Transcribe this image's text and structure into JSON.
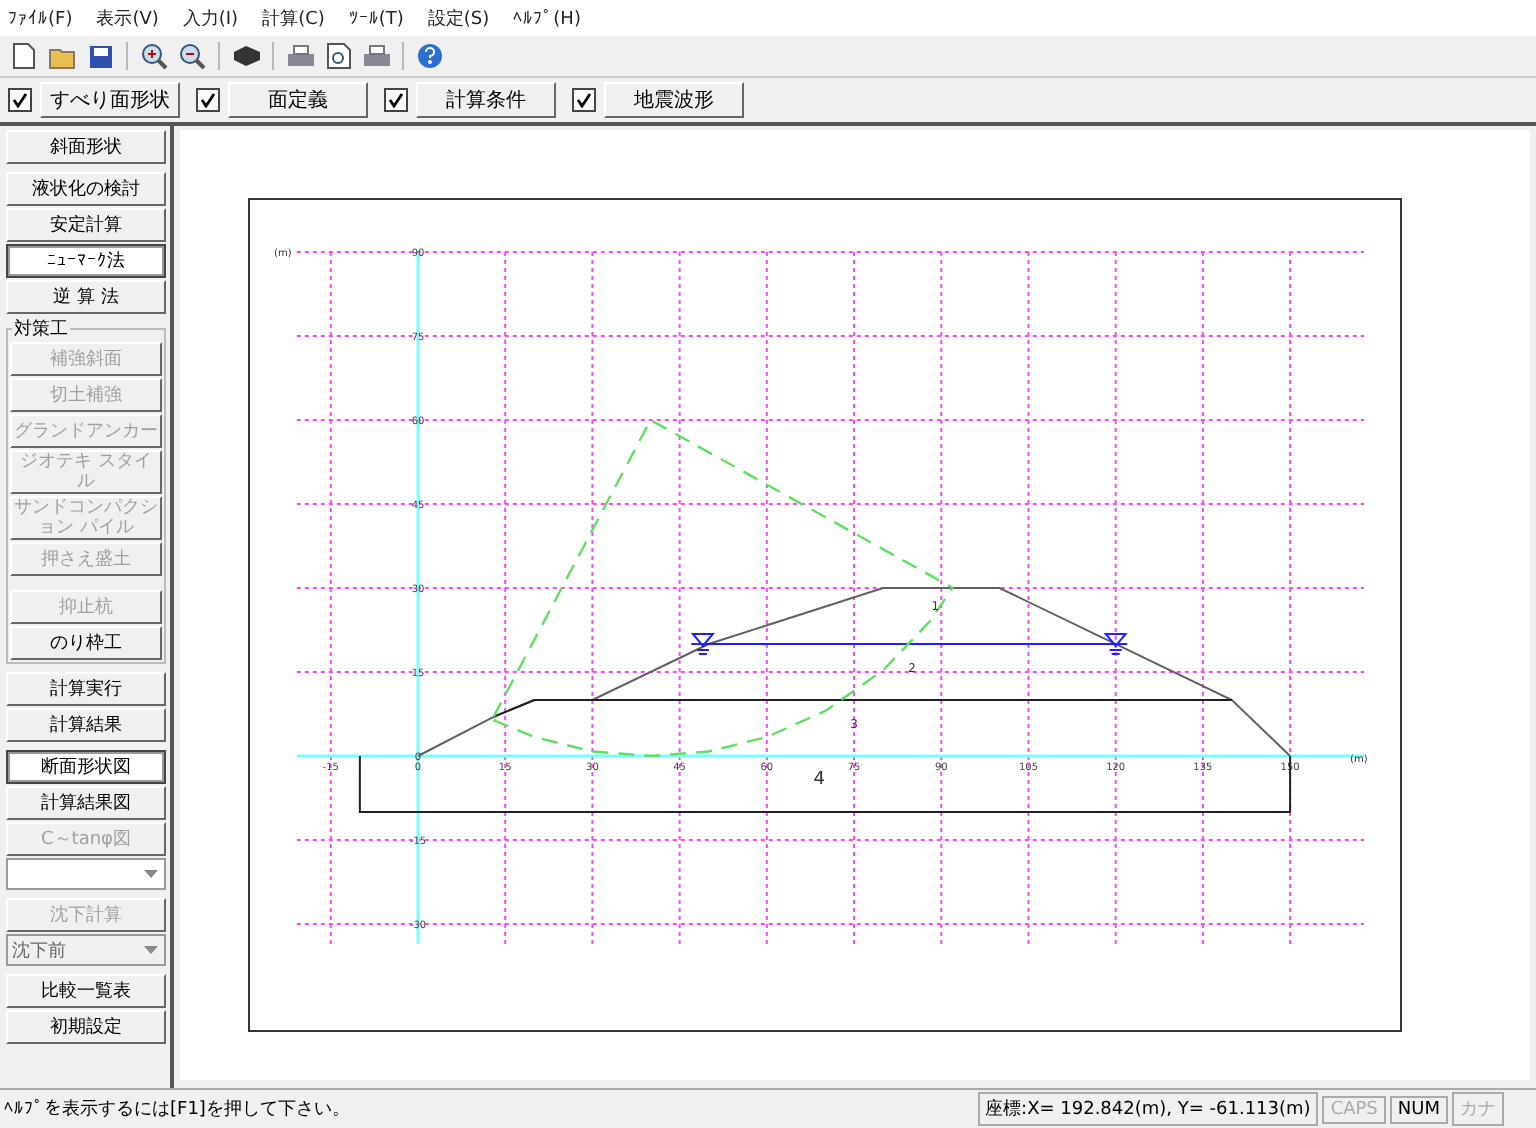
{
  "menu": [
    "ﾌｧｲﾙ(F)",
    "表示(V)",
    "入力(I)",
    "計算(C)",
    "ﾂｰﾙ(T)",
    "設定(S)",
    "ﾍﾙﾌﾟ(H)"
  ],
  "toolbar": [
    {
      "kind": "new"
    },
    {
      "kind": "open"
    },
    {
      "kind": "save"
    },
    {
      "kind": "sep"
    },
    {
      "kind": "zoom-in"
    },
    {
      "kind": "zoom-out"
    },
    {
      "kind": "sep"
    },
    {
      "kind": "box"
    },
    {
      "kind": "sep"
    },
    {
      "kind": "print"
    },
    {
      "kind": "preview"
    },
    {
      "kind": "print"
    },
    {
      "kind": "sep"
    },
    {
      "kind": "help"
    }
  ],
  "view_toggles": [
    {
      "label": "すべり面形状",
      "checked": true
    },
    {
      "label": "面定義",
      "checked": true
    },
    {
      "label": "計算条件",
      "checked": true
    },
    {
      "label": "地震波形",
      "checked": true
    }
  ],
  "sidebar": {
    "sections": [
      {
        "items": [
          {
            "kind": "button",
            "label": "斜面形状",
            "disabled": false,
            "selected": false
          }
        ]
      },
      {
        "items": [
          {
            "kind": "button",
            "label": "液状化の検討",
            "disabled": false,
            "selected": false
          },
          {
            "kind": "button",
            "label": "安定計算",
            "disabled": false,
            "selected": false
          },
          {
            "kind": "button",
            "label": "ﾆｭｰﾏｰｸ法",
            "disabled": false,
            "selected": true
          },
          {
            "kind": "button",
            "label": "逆 算 法",
            "disabled": false,
            "selected": false
          }
        ]
      },
      {
        "label": "対策工",
        "items": [
          {
            "kind": "button",
            "label": "補強斜面",
            "disabled": true,
            "selected": false
          },
          {
            "kind": "button",
            "label": "切土補強",
            "disabled": true,
            "selected": false
          },
          {
            "kind": "button",
            "label": "グランドアンカー",
            "disabled": true,
            "selected": false
          },
          {
            "kind": "button",
            "label": "ジオテキ スタイル",
            "disabled": true,
            "selected": false
          },
          {
            "kind": "button",
            "label": "サンドコンパクション パイル",
            "disabled": true,
            "selected": false
          },
          {
            "kind": "button",
            "label": "押さえ盛土",
            "disabled": true,
            "selected": false
          },
          {
            "kind": "gap"
          },
          {
            "kind": "button",
            "label": "抑止杭",
            "disabled": true,
            "selected": false
          },
          {
            "kind": "button",
            "label": "のり枠工",
            "disabled": false,
            "selected": false
          }
        ]
      },
      {
        "items": [
          {
            "kind": "button",
            "label": "計算実行",
            "disabled": false,
            "selected": false
          },
          {
            "kind": "button",
            "label": "計算結果",
            "disabled": false,
            "selected": false
          }
        ]
      },
      {
        "items": [
          {
            "kind": "button",
            "label": "断面形状図",
            "disabled": false,
            "selected": true
          },
          {
            "kind": "button",
            "label": "計算結果図",
            "disabled": false,
            "selected": false
          },
          {
            "kind": "button",
            "label": "C～tanφ図",
            "disabled": true,
            "selected": false
          },
          {
            "kind": "select",
            "disabled": false
          }
        ]
      },
      {
        "items": [
          {
            "kind": "button",
            "label": "沈下計算",
            "disabled": true,
            "selected": false
          },
          {
            "kind": "select",
            "value": "沈下前",
            "disabled": true
          }
        ]
      },
      {
        "items": [
          {
            "kind": "button",
            "label": "比較一覧表",
            "disabled": false,
            "selected": false
          },
          {
            "kind": "button",
            "label": "初期設定",
            "disabled": false,
            "selected": false
          }
        ]
      }
    ]
  },
  "axis_units": {
    "x": "(m)",
    "y": "(m)"
  },
  "layer_numbers": [
    "1",
    "2",
    "3",
    "4"
  ],
  "chart_data": {
    "type": "line",
    "grid": true,
    "xlim": [
      -15,
      150
    ],
    "ylim": [
      -30,
      90
    ],
    "xticks": [
      -15,
      0,
      15,
      30,
      45,
      60,
      75,
      90,
      105,
      120,
      135,
      150
    ],
    "yticks": [
      -30,
      -15,
      0,
      15,
      30,
      45,
      60,
      75,
      90
    ],
    "series": [
      {
        "color": "#606060",
        "x": [
          0,
          13,
          20,
          30,
          50,
          80,
          100,
          140,
          150
        ],
        "values": [
          0,
          7,
          10,
          10,
          20,
          30,
          30,
          10,
          0
        ]
      },
      {
        "color": "#202020",
        "x": [
          13,
          20,
          140
        ],
        "values": [
          7,
          10,
          10
        ]
      },
      {
        "color": "#202020",
        "x": [
          -10,
          -10,
          150,
          150
        ],
        "values": [
          0,
          -10,
          -10,
          0
        ]
      },
      {
        "color": "#2020ff",
        "x": [
          47,
          122
        ],
        "values": [
          20,
          20
        ]
      },
      {
        "color": "#60e060",
        "line_style": "dashed",
        "x": [
          13,
          40,
          92
        ],
        "values": [
          7,
          60,
          30
        ]
      },
      {
        "color": "#60e060",
        "line_style": "dashed",
        "x": [
          13,
          20,
          30,
          40,
          50,
          60,
          70,
          80,
          88,
          92
        ],
        "values": [
          6.4,
          3.4,
          0.8,
          0,
          0.8,
          3.4,
          8,
          15.3,
          24,
          30.1
        ]
      }
    ]
  },
  "status_bar": {
    "help": "ﾍﾙﾌﾟを表示するには[F1]を押して下さい。",
    "coords": "座標:X= 192.842(m), Y= -61.113(m)",
    "indicators": [
      {
        "label": "CAPS",
        "on": false
      },
      {
        "label": "NUM",
        "on": true
      },
      {
        "label": "カナ",
        "on": false
      }
    ]
  }
}
